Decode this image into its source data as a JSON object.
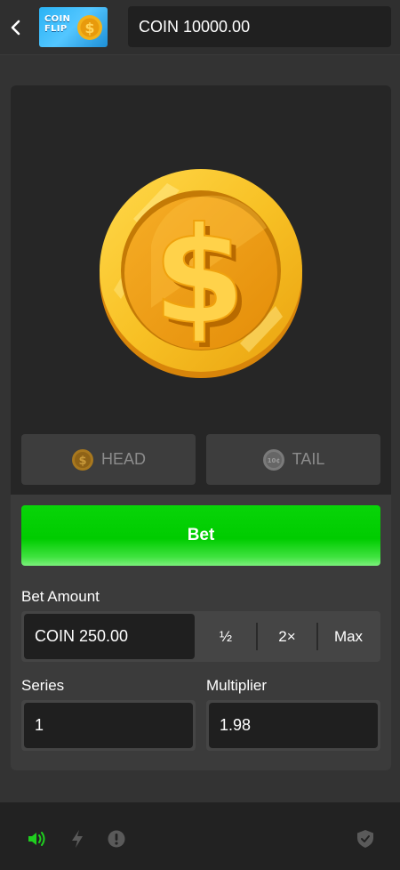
{
  "header": {
    "back_icon": "chevron-left-icon",
    "logo_line1": "COIN",
    "logo_line2": "FLIP",
    "balance": "COIN 10000.00"
  },
  "game": {
    "coin_icon": "gold-dollar-coin",
    "head_label": "HEAD",
    "tail_label": "TAIL",
    "bet_button": "Bet"
  },
  "bet_amount": {
    "label": "Bet Amount",
    "value": "COIN 250.00",
    "half": "½",
    "double": "2×",
    "max": "Max"
  },
  "series": {
    "label": "Series",
    "value": "1"
  },
  "multiplier": {
    "label": "Multiplier",
    "value": "1.98"
  },
  "footer": {
    "icons": [
      "speaker-icon",
      "lightning-icon",
      "info-icon",
      "shield-icon"
    ]
  },
  "colors": {
    "accent_green": "#00cc00",
    "coin_gold": "#f5b51c",
    "background": "#333333",
    "panel": "#3b3b3b",
    "stage": "#262626"
  }
}
